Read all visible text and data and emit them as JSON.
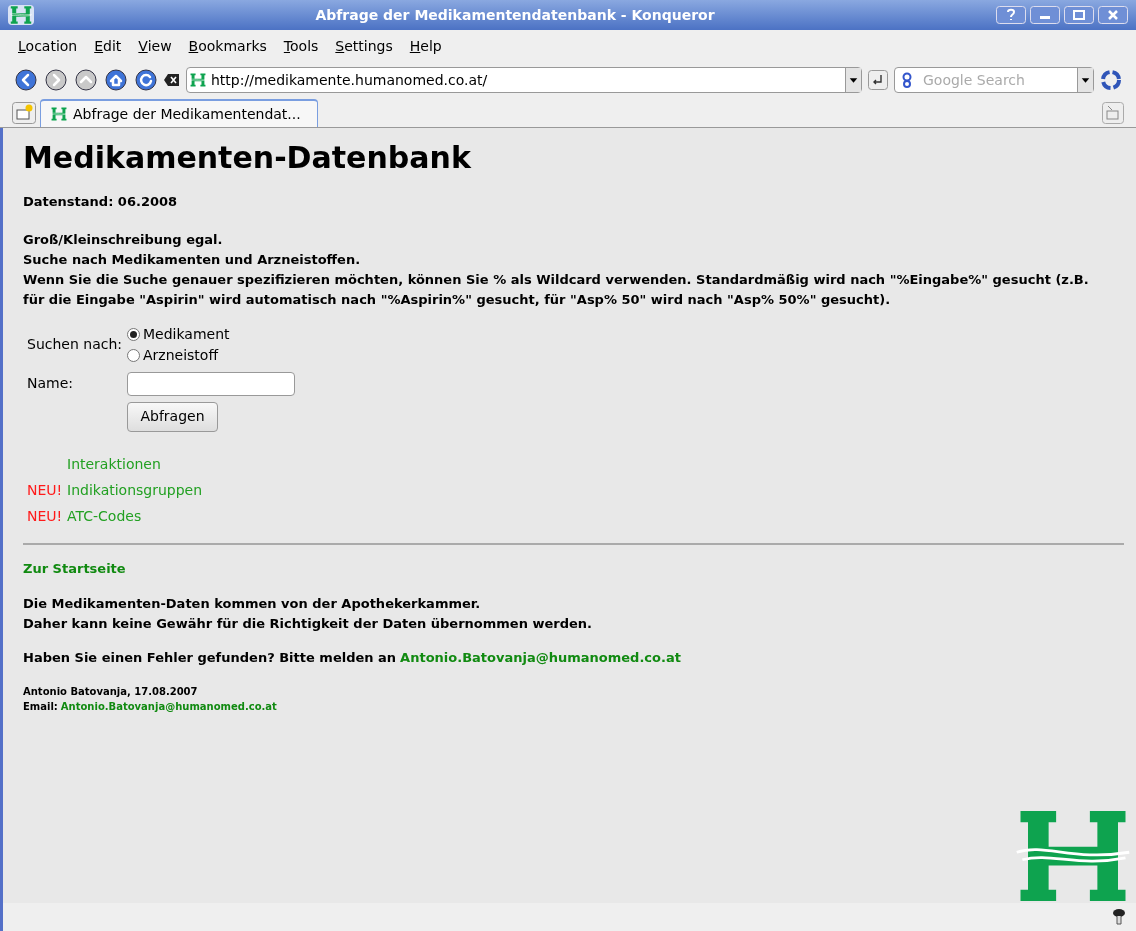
{
  "window": {
    "title": "Abfrage der Medikamentendatenbank - Konqueror"
  },
  "menu": [
    {
      "label": "Location"
    },
    {
      "label": "Edit"
    },
    {
      "label": "View"
    },
    {
      "label": "Bookmarks"
    },
    {
      "label": "Tools"
    },
    {
      "label": "Settings"
    },
    {
      "label": "Help"
    }
  ],
  "toolbar": {
    "url": "http://medikamente.humanomed.co.at/",
    "search_placeholder": "Google Search"
  },
  "tabs": [
    {
      "label": "Abfrage der Medikamentendat...",
      "selected": true
    }
  ],
  "page": {
    "heading": "Medikamenten-Datenbank",
    "data_status": "Datenstand: 06.2008",
    "notes": [
      "Groß/Kleinschreibung egal.",
      "Suche nach Medikamenten und Arzneistoffen.",
      "Wenn Sie die Suche genauer spezifizieren möchten, können Sie % als Wildcard verwenden. Standardmäßig wird nach \"%Eingabe%\" gesucht (z.B. für die Eingabe \"Aspirin\" wird automatisch nach \"%Aspirin%\" gesucht, für \"Asp% 50\" wird nach \"Asp% 50%\" gesucht)."
    ],
    "form": {
      "search_by_label": "Suchen nach:",
      "options": [
        {
          "label": "Medikament",
          "selected": true
        },
        {
          "label": "Arzneistoff",
          "selected": false
        }
      ],
      "name_label": "Name:",
      "submit": "Abfragen"
    },
    "links": [
      {
        "label": "Interaktionen"
      },
      {
        "badge": "NEU!",
        "label": "Indikationsgruppen"
      },
      {
        "badge": "NEU!",
        "label": "ATC-Codes"
      }
    ],
    "home_link": "Zur Startseite",
    "disclaimer": [
      "Die Medikamenten-Daten kommen von der Apothekerkammer.",
      "Daher kann keine Gewähr für die Richtigkeit der Daten übernommen werden."
    ],
    "report": {
      "text": "Haben Sie einen Fehler gefunden? Bitte melden an",
      "email": "Antonio.Batovanja@humanomed.co.at"
    },
    "author": "Antonio Batovanja, 17.08.2007",
    "contact": {
      "label": "Email:",
      "email": "Antonio.Batovanja@humanomed.co.at"
    }
  }
}
